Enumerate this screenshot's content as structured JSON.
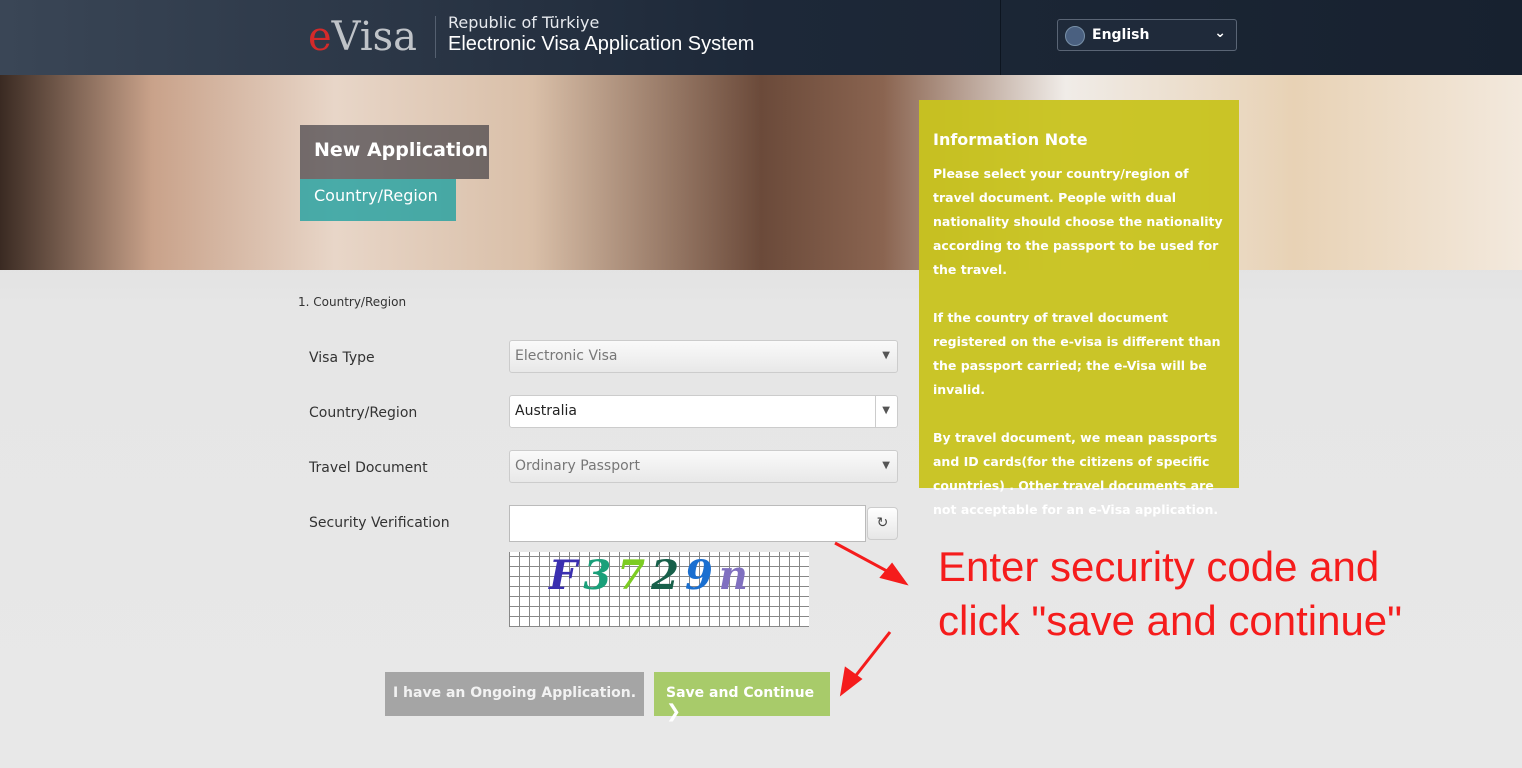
{
  "header": {
    "logo": "e-Visa",
    "logo_e": "e",
    "logo_rest": "Visa",
    "republic": "Republic of Türkiye",
    "system": "Electronic Visa Application System",
    "language": "English"
  },
  "banner": {
    "title": "New Application",
    "tab": "Country/Region"
  },
  "info": {
    "title": "Information Note",
    "paragraphs": [
      "Please select your country/region of travel document. People with dual nationality should choose the nationality according to the passport to be used for the travel.",
      "If the country of travel document registered on the e-visa is different than the passport carried; the e-Visa will be invalid.",
      "By travel document, we mean passports and ID cards(for the citizens of specific countries) . Other travel documents are not acceptable for an e-Visa application."
    ]
  },
  "form": {
    "step": "1. Country/Region",
    "visa_type": {
      "label": "Visa Type",
      "value": "Electronic Visa"
    },
    "country": {
      "label": "Country/Region",
      "value": "Australia"
    },
    "document": {
      "label": "Travel Document",
      "value": "Ordinary Passport"
    },
    "security": {
      "label": "Security Verification",
      "value": "",
      "captcha": "F372gn"
    }
  },
  "buttons": {
    "ongoing": "I have an Ongoing Application.",
    "save": "Save and Continue"
  },
  "annotation": {
    "line1": "Enter security code and",
    "line2": "click \"save and continue\"",
    "color": "#f51c1c"
  }
}
